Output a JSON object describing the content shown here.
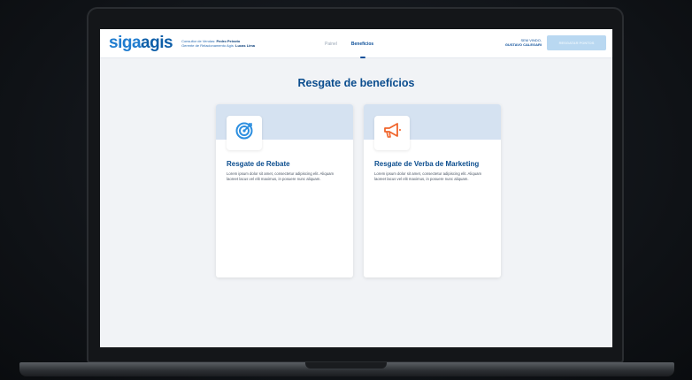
{
  "header": {
    "logo_part1": "siga",
    "logo_part2": "agis",
    "consultant_label": "Consultor de Vendas:",
    "consultant_name": "Pedro Peixoto",
    "manager_label": "Gerente de Relacionamento Agis:",
    "manager_name": "Lucas Lima",
    "nav": [
      {
        "label": "Painel",
        "active": false
      },
      {
        "label": "Benefícios",
        "active": true
      }
    ],
    "greeting": "SEM VINDO,",
    "user_name": "GUSTAVO CALEGARI",
    "logout_label": "RESGATAR PONTOS"
  },
  "page": {
    "title": "Resgate de benefícios"
  },
  "cards": [
    {
      "title": "Resgate de Rebate",
      "description": "Lorem ipsum dolor sit amet, consectetur adipiscing elit. Aliquam laoreet lacus vel elit maximus, in posuere nunc aliquam.",
      "icon": "target-icon"
    },
    {
      "title": "Resgate de Verba de Marketing",
      "description": "Lorem ipsum dolor sit amet, consectetur adipiscing elit. Aliquam laoreet lacus vel elit maximus, in posuere nunc aliquam.",
      "icon": "megaphone-icon"
    }
  ],
  "colors": {
    "brand_blue": "#0b4d8e",
    "logo_blue": "#1f7ccf",
    "band": "#d5e2f1",
    "target_icon": "#2d8fe0",
    "megaphone_icon": "#f0662d"
  }
}
